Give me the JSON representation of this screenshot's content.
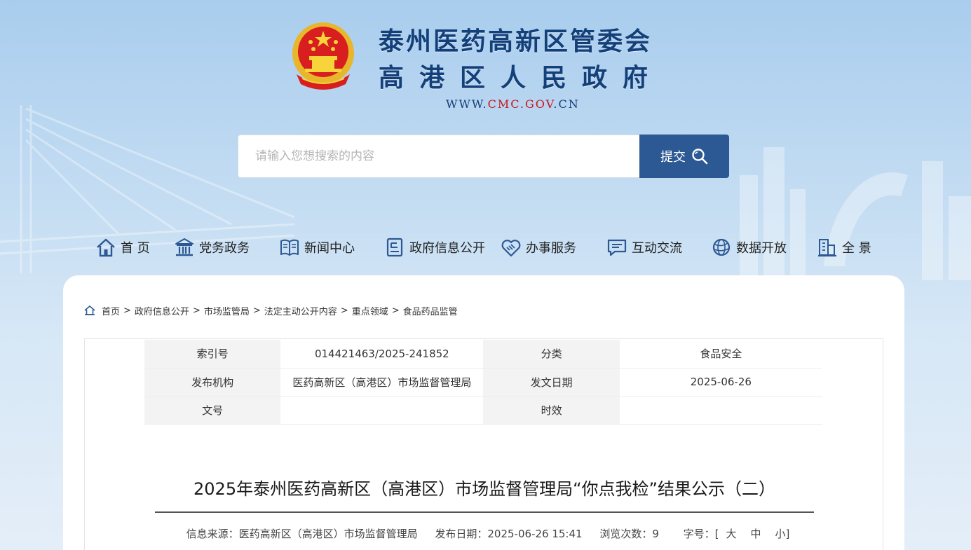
{
  "header": {
    "title_line1": "泰州医药高新区管委会",
    "title_line2": "高港区人民政府",
    "url_prefix": "WWW.",
    "url_highlight": "CMC.GOV",
    "url_suffix": ".CN"
  },
  "search": {
    "placeholder": "请输入您想搜索的内容",
    "submit_label": "提交"
  },
  "nav": [
    {
      "label": "首 页",
      "icon": "home-icon"
    },
    {
      "label": "党务政务",
      "icon": "building-icon"
    },
    {
      "label": "新闻中心",
      "icon": "book-icon"
    },
    {
      "label": "政府信息公开",
      "icon": "document-icon"
    },
    {
      "label": "办事服务",
      "icon": "handshake-icon"
    },
    {
      "label": "互动交流",
      "icon": "chat-icon"
    },
    {
      "label": "数据开放",
      "icon": "globe-icon"
    },
    {
      "label": "全 景",
      "icon": "city-icon"
    }
  ],
  "breadcrumb": [
    "首页",
    "政府信息公开",
    "市场监管局",
    "法定主动公开内容",
    "重点领域",
    "食品药品监管"
  ],
  "meta": {
    "index_label": "索引号",
    "index_value": "014421463/2025-241852",
    "category_label": "分类",
    "category_value": "食品安全",
    "publisher_label": "发布机构",
    "publisher_value": "医药高新区（高港区）市场监督管理局",
    "date_label": "发文日期",
    "date_value": "2025-06-26",
    "docno_label": "文号",
    "docno_value": "",
    "validity_label": "时效",
    "validity_value": ""
  },
  "article": {
    "title": "2025年泰州医药高新区（高港区）市场监督管理局“你点我检”结果公示（二）",
    "source": "信息来源：医药高新区（高港区）市场监督管理局",
    "publish_date": "发布日期：2025-06-26 15:41",
    "views": "浏览次数：9",
    "font_size_label": "字号：[",
    "font_large": "大",
    "font_medium": "中",
    "font_small": "小]"
  }
}
